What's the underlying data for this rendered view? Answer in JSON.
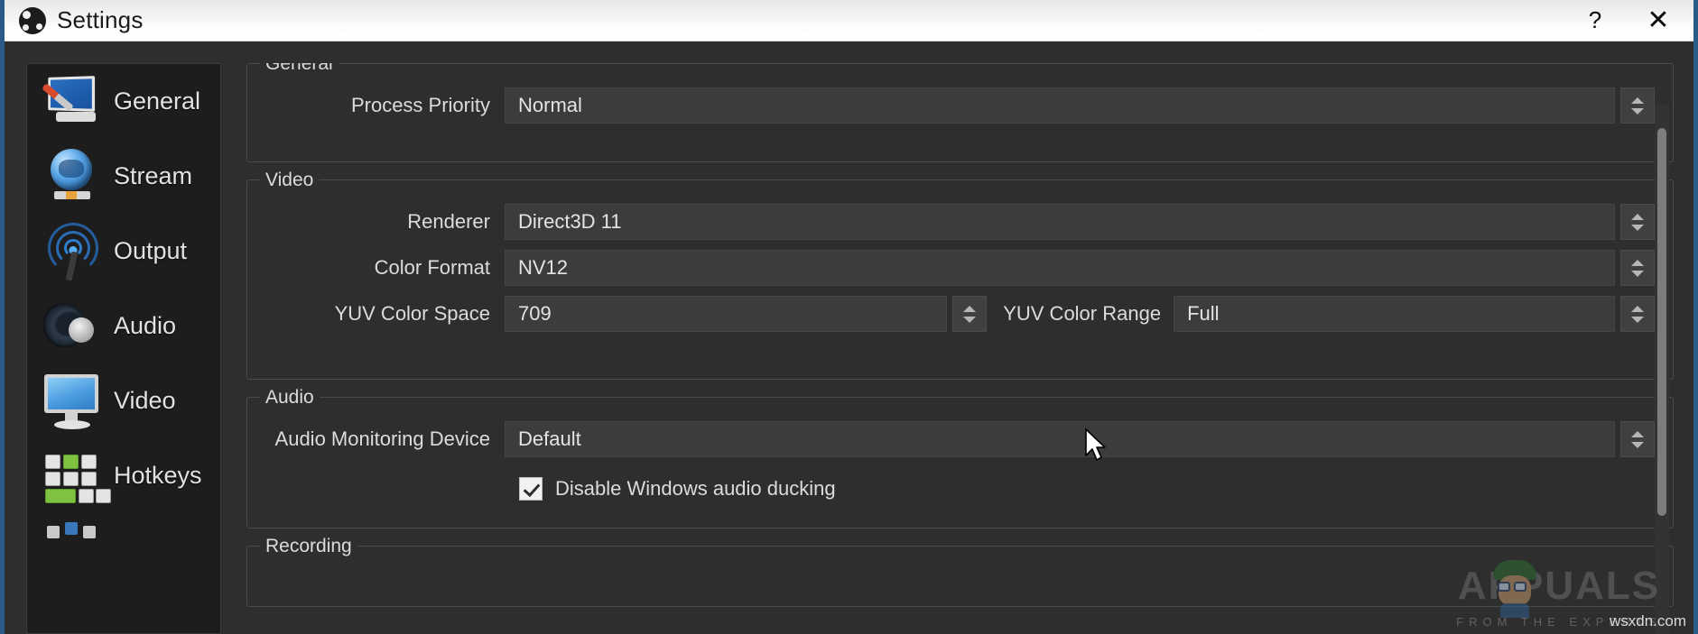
{
  "window": {
    "title": "Settings",
    "logo_icon": "obs-logo-icon",
    "help_label": "?",
    "close_label": "✕",
    "accent_border": "#2a5b86"
  },
  "sidebar": {
    "items": [
      {
        "label": "General",
        "icon": "monitor-screwdriver-icon"
      },
      {
        "label": "Stream",
        "icon": "globe-cable-icon"
      },
      {
        "label": "Output",
        "icon": "broadcast-waves-icon"
      },
      {
        "label": "Audio",
        "icon": "speaker-icon"
      },
      {
        "label": "Video",
        "icon": "monitor-icon"
      },
      {
        "label": "Hotkeys",
        "icon": "keyboard-keys-icon"
      },
      {
        "label": "",
        "icon": "advanced-blocks-icon"
      }
    ]
  },
  "content": {
    "groups": [
      {
        "title": "General",
        "rows": [
          {
            "label": "Process Priority",
            "value": "Normal",
            "control": "combobox"
          }
        ]
      },
      {
        "title": "Video",
        "rows": [
          {
            "label": "Renderer",
            "value": "Direct3D 11",
            "control": "combobox"
          },
          {
            "label": "Color Format",
            "value": "NV12",
            "control": "combobox"
          },
          {
            "label": "YUV Color Space",
            "value": "709",
            "control": "combobox",
            "second_label": "YUV Color Range",
            "second_value": "Full"
          }
        ]
      },
      {
        "title": "Audio",
        "rows": [
          {
            "label": "Audio Monitoring Device",
            "value": "Default",
            "control": "combobox"
          }
        ],
        "checkbox": {
          "label": "Disable Windows audio ducking",
          "checked": true
        }
      },
      {
        "title": "Recording",
        "rows": []
      }
    ]
  },
  "scrollbar": {
    "name": "vertical-scrollbar"
  },
  "watermark": {
    "brand": "APPUALS",
    "tagline": "FROM THE EXPERTS",
    "url": "wsxdn.com"
  }
}
